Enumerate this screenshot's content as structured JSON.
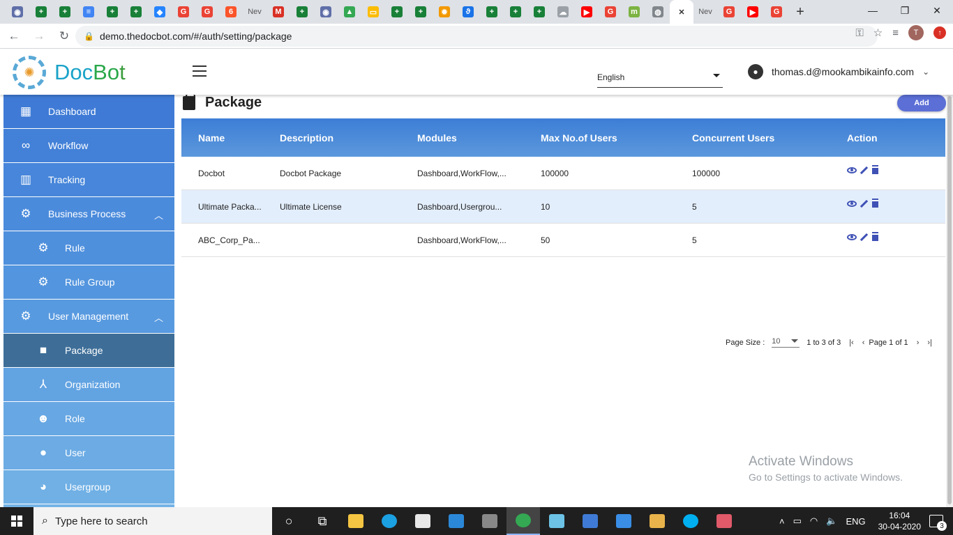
{
  "browser": {
    "tabs": [
      {
        "icon": "chromium-icon",
        "color": "#5f6fa8",
        "glyph": "◉"
      },
      {
        "icon": "sheets-icon",
        "color": "#188038",
        "glyph": "+"
      },
      {
        "icon": "sheets-icon",
        "color": "#188038",
        "glyph": "+"
      },
      {
        "icon": "docs-icon",
        "color": "#4285f4",
        "glyph": "≡"
      },
      {
        "icon": "sheets-icon",
        "color": "#188038",
        "glyph": "+"
      },
      {
        "icon": "sheets-icon",
        "color": "#188038",
        "glyph": "+"
      },
      {
        "icon": "jira-icon",
        "color": "#2684ff",
        "glyph": "◆"
      },
      {
        "icon": "google-icon",
        "color": "#ea4335",
        "glyph": "G"
      },
      {
        "icon": "google-icon",
        "color": "#ea4335",
        "glyph": "G"
      },
      {
        "icon": "brave-icon",
        "color": "#fb542b",
        "glyph": "6"
      },
      {
        "icon": "newtab-icon",
        "text": "Nev"
      },
      {
        "icon": "gmail-icon",
        "color": "#d93025",
        "glyph": "M"
      },
      {
        "icon": "sheets-icon",
        "color": "#188038",
        "glyph": "+"
      },
      {
        "icon": "chromium-icon",
        "color": "#5f6fa8",
        "glyph": "◉"
      },
      {
        "icon": "drive-icon",
        "color": "#34a853",
        "glyph": "▲"
      },
      {
        "icon": "slides-icon",
        "color": "#fbbc04",
        "glyph": "▭"
      },
      {
        "icon": "sheets-icon",
        "color": "#188038",
        "glyph": "+"
      },
      {
        "icon": "sheets-icon",
        "color": "#188038",
        "glyph": "+"
      },
      {
        "icon": "sun-icon",
        "color": "#f29900",
        "glyph": "✹"
      },
      {
        "icon": "fingerprint-icon",
        "color": "#1a73e8",
        "glyph": "ϑ"
      },
      {
        "icon": "sheets-icon",
        "color": "#188038",
        "glyph": "+"
      },
      {
        "icon": "sheets-icon",
        "color": "#188038",
        "glyph": "+"
      },
      {
        "icon": "sheets-icon",
        "color": "#188038",
        "glyph": "+"
      },
      {
        "icon": "cloud-icon",
        "color": "#9aa0a6",
        "glyph": "☁"
      },
      {
        "icon": "youtube-icon",
        "color": "#ff0000",
        "glyph": "▶"
      },
      {
        "icon": "google-icon",
        "color": "#ea4335",
        "glyph": "G"
      },
      {
        "icon": "meet-icon",
        "color": "#7cb342",
        "glyph": "m"
      },
      {
        "icon": "globe-icon",
        "color": "#80868b",
        "glyph": "◍"
      },
      {
        "icon": "close-tab-icon",
        "active": true,
        "glyph": "✕"
      },
      {
        "icon": "newtab-icon",
        "text": "Nev"
      },
      {
        "icon": "google-icon",
        "color": "#ea4335",
        "glyph": "G"
      },
      {
        "icon": "youtube-icon",
        "color": "#ff0000",
        "glyph": "▶"
      },
      {
        "icon": "google-icon",
        "color": "#ea4335",
        "glyph": "G"
      }
    ],
    "url": "demo.thedocbot.com/#/auth/setting/package",
    "profile_initial": "T"
  },
  "header": {
    "brand": {
      "part1": "Doc",
      "part2": "Bo",
      "part3": "t"
    },
    "language": "English",
    "user_email": "thomas.d@mookambikainfo.com"
  },
  "sidebar": {
    "items": [
      {
        "label": "Dashboard",
        "icon": "dashboard-icon",
        "glyph": "▦",
        "color": "#3f7bd6",
        "sub": false
      },
      {
        "label": "Workflow",
        "icon": "infinity-icon",
        "glyph": "∞",
        "color": "#4381d8",
        "sub": false
      },
      {
        "label": "Tracking",
        "icon": "table-icon",
        "glyph": "▥",
        "color": "#4786da",
        "sub": false
      },
      {
        "label": "Business Process",
        "icon": "gear-icon",
        "glyph": "⚙",
        "color": "#4b8bdc",
        "sub": false,
        "expanded": true
      },
      {
        "label": "Rule",
        "icon": "gear-icon",
        "glyph": "⚙",
        "color": "#4f90dd",
        "sub": true
      },
      {
        "label": "Rule Group",
        "icon": "gear-icon",
        "glyph": "⚙",
        "color": "#5395de",
        "sub": true
      },
      {
        "label": "User Management",
        "icon": "gear-icon",
        "glyph": "⚙",
        "color": "#589ae0",
        "sub": false,
        "expanded": true
      },
      {
        "label": "Package",
        "icon": "bag-icon",
        "glyph": "■",
        "color": "#3e6e98",
        "sub": true,
        "active": true
      },
      {
        "label": "Organization",
        "icon": "hierarchy-icon",
        "glyph": "⅄",
        "color": "#62a3e2",
        "sub": true
      },
      {
        "label": "Role",
        "icon": "user-check-icon",
        "glyph": "☻",
        "color": "#67a7e3",
        "sub": true
      },
      {
        "label": "User",
        "icon": "person-icon",
        "glyph": "●",
        "color": "#6cabe4",
        "sub": true
      },
      {
        "label": "Usergroup",
        "icon": "group-icon",
        "glyph": "◕",
        "color": "#70b0e5",
        "sub": true
      },
      {
        "label": "",
        "icon": "",
        "glyph": "",
        "color": "#74b3e6",
        "sub": true
      }
    ]
  },
  "main": {
    "title": "Package",
    "add_label": "Add",
    "columns": [
      "Name",
      "Description",
      "Modules",
      "Max No.of Users",
      "Concurrent Users",
      "Action"
    ],
    "rows": [
      {
        "name": "Docbot",
        "description": "Docbot Package",
        "modules": "Dashboard,WorkFlow,...",
        "max_users": "100000",
        "concurrent": "100000"
      },
      {
        "name": "Ultimate Packa...",
        "description": "Ultimate License",
        "modules": "Dashboard,Usergrou...",
        "max_users": "10",
        "concurrent": "5"
      },
      {
        "name": "ABC_Corp_Pa...",
        "description": "",
        "modules": "Dashboard,WorkFlow,...",
        "max_users": "50",
        "concurrent": "5"
      }
    ],
    "pager": {
      "page_size_label": "Page Size :",
      "page_size": "10",
      "range": "1 to 3 of 3",
      "page_text": "Page 1 of 1"
    }
  },
  "watermark": {
    "line1": "Activate Windows",
    "line2": "Go to Settings to activate Windows."
  },
  "taskbar": {
    "search_placeholder": "Type here to search",
    "apps": [
      {
        "icon": "cortana-icon",
        "color": "#1f1f1f",
        "glyph": "○"
      },
      {
        "icon": "task-view-icon",
        "color": "#1f1f1f",
        "glyph": "⧉"
      },
      {
        "icon": "file-explorer-icon",
        "color": "#f4c542",
        "glyph": ""
      },
      {
        "icon": "edge-icon",
        "color": "#1ba0e2",
        "glyph": ""
      },
      {
        "icon": "store-icon",
        "color": "#e8e8e8",
        "glyph": ""
      },
      {
        "icon": "mail-icon",
        "color": "#2b88d8",
        "glyph": ""
      },
      {
        "icon": "security-icon",
        "color": "#888888",
        "glyph": ""
      },
      {
        "icon": "chrome-icon",
        "color": "#34a853",
        "glyph": "",
        "active": true
      },
      {
        "icon": "notes-icon",
        "color": "#6cc3e6",
        "glyph": ""
      },
      {
        "icon": "wps-icon",
        "color": "#3f7bd6",
        "glyph": ""
      },
      {
        "icon": "photos-icon",
        "color": "#3a8ee6",
        "glyph": ""
      },
      {
        "icon": "paint-icon",
        "color": "#e8b34a",
        "glyph": ""
      },
      {
        "icon": "skype-icon",
        "color": "#00aff0",
        "glyph": ""
      },
      {
        "icon": "snip-icon",
        "color": "#e05a6a",
        "glyph": ""
      }
    ],
    "tray_lang": "ENG",
    "time": "16:04",
    "date": "30-04-2020",
    "notif_count": "3"
  }
}
